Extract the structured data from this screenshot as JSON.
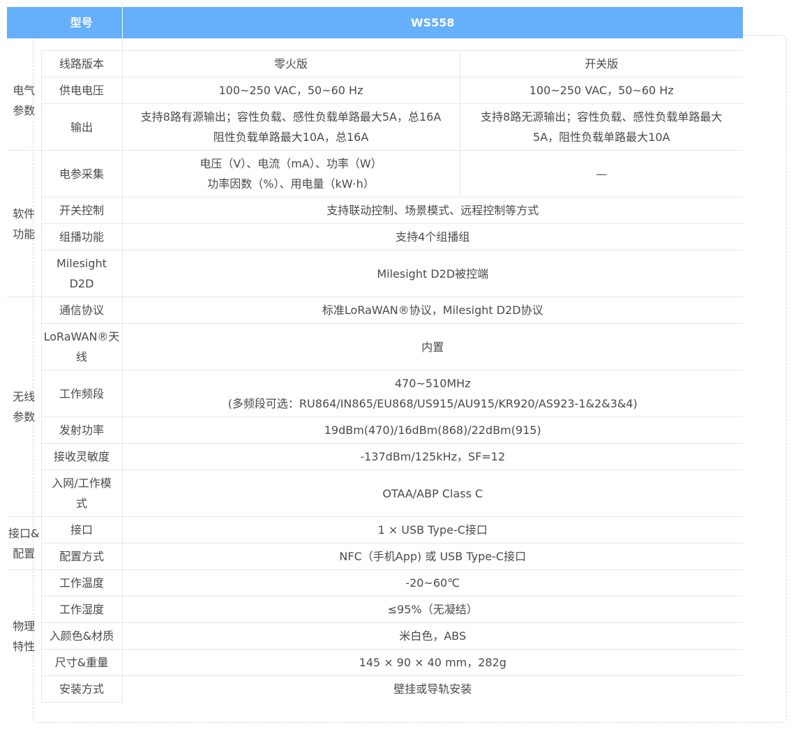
{
  "header": {
    "model_label": "型号",
    "model_value": "WS558"
  },
  "sections": [
    {
      "category": "电气\n参数",
      "rows": [
        {
          "field": "线路版本",
          "values": [
            "零火版",
            "开关版"
          ]
        },
        {
          "field": "供电电压",
          "values": [
            "100~250 VAC，50~60 Hz",
            "100~250 VAC，50~60 Hz"
          ]
        },
        {
          "field": "输出",
          "values": [
            "支持8路有源输出；容性负载、感性负载单路最大5A，总16A\n阻性负载单路最大10A，总16A",
            "支持8路无源输出；容性负载、感性负载单路最大\n5A，阻性负载单路最大10A"
          ]
        }
      ]
    },
    {
      "category": "软件\n功能",
      "rows": [
        {
          "field": "电参采集",
          "values": [
            "电压（V）、电流（mA）、功率（W）\n功率因数（%）、用电量（kW·h）",
            "—"
          ]
        },
        {
          "field": "开关控制",
          "values": [
            "支持联动控制、场景模式、远程控制等方式"
          ]
        },
        {
          "field": "组播功能",
          "values": [
            "支持4个组播组"
          ]
        },
        {
          "field": "Milesight\nD2D",
          "values": [
            "Milesight D2D被控端"
          ]
        }
      ]
    },
    {
      "category": "无线\n参数",
      "rows": [
        {
          "field": "通信协议",
          "values": [
            "标准LoRaWAN®协议，Milesight D2D协议"
          ]
        },
        {
          "field": "LoRaWAN®天\n线",
          "values": [
            "内置"
          ]
        },
        {
          "field": "工作频段",
          "values": [
            "470~510MHz\n(多频段可选：RU864/IN865/EU868/US915/AU915/KR920/AS923-1&2&3&4)"
          ]
        },
        {
          "field": "发射功率",
          "values": [
            "19dBm(470)/16dBm(868)/22dBm(915)"
          ]
        },
        {
          "field": "接收灵敏度",
          "values": [
            "-137dBm/125kHz，SF=12"
          ]
        },
        {
          "field": "入网/工作模\n式",
          "values": [
            "OTAA/ABP Class C"
          ]
        }
      ]
    },
    {
      "category": "接口&\n配置",
      "rows": [
        {
          "field": "接口",
          "values": [
            "1 × USB Type-C接口"
          ]
        },
        {
          "field": "配置方式",
          "values": [
            "NFC（手机App) 或 USB Type-C接口"
          ]
        }
      ]
    },
    {
      "category": "物理\n特性",
      "rows": [
        {
          "field": "工作温度",
          "values": [
            "-20~60℃"
          ]
        },
        {
          "field": "工作湿度",
          "values": [
            "≤95%（无凝结）"
          ]
        },
        {
          "field": "入颜色&材质",
          "values": [
            "米白色，ABS"
          ]
        },
        {
          "field": "尺寸&重量",
          "values": [
            "145 × 90 × 40 mm，282g"
          ]
        },
        {
          "field": "安装方式",
          "values": [
            "壁挂或导轨安装"
          ]
        }
      ]
    }
  ]
}
